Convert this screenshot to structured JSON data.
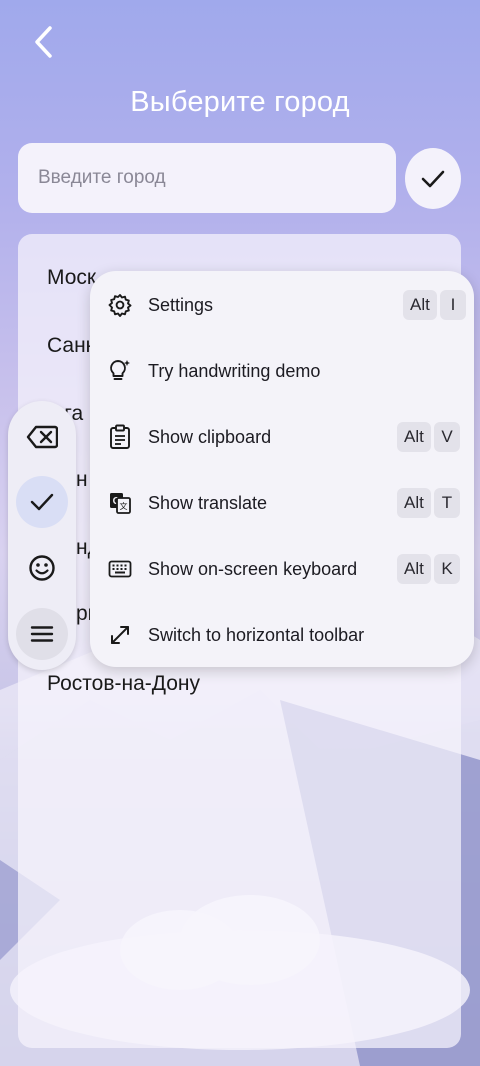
{
  "header": {
    "title": "Выберите город"
  },
  "search": {
    "placeholder": "Введите город",
    "value": ""
  },
  "icons": {
    "back": "chevron-left-icon",
    "confirm": "check-icon",
    "backspace": "backspace-icon",
    "check": "check-icon",
    "emoji": "emoji-icon",
    "menu": "hamburger-icon"
  },
  "cities": [
    {
      "label": "Моск"
    },
    {
      "label": "Санк"
    },
    {
      "label": "лга"
    },
    {
      "label": "н"
    },
    {
      "label": "нд"
    },
    {
      "label": "ри"
    },
    {
      "label": "Ростов-на-Дону"
    }
  ],
  "menu": {
    "items": [
      {
        "label": "Settings",
        "icon": "gear-icon",
        "keys": [
          "Alt",
          "I"
        ]
      },
      {
        "label": "Try handwriting demo",
        "icon": "lightbulb-sparkle-icon",
        "keys": []
      },
      {
        "label": "Show clipboard",
        "icon": "clipboard-icon",
        "keys": [
          "Alt",
          "V"
        ]
      },
      {
        "label": "Show translate",
        "icon": "translate-icon",
        "keys": [
          "Alt",
          "T"
        ]
      },
      {
        "label": "Show on-screen keyboard",
        "icon": "keyboard-icon",
        "keys": [
          "Alt",
          "K"
        ]
      },
      {
        "label": "Switch to horizontal toolbar",
        "icon": "expand-diagonal-icon",
        "keys": []
      }
    ]
  },
  "colors": {
    "accent_active": "#d9def5",
    "panel": "#f4f2fb",
    "title": "#ffffff"
  }
}
